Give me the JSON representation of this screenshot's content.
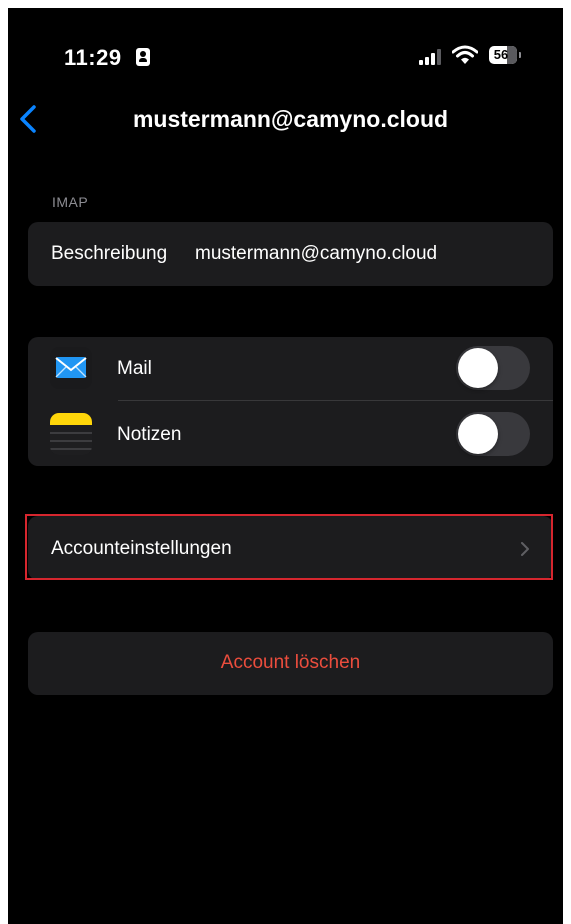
{
  "status_bar": {
    "time": "11:29",
    "battery": "56",
    "icons": [
      "contact-card-icon",
      "signal-icon",
      "wifi-icon",
      "battery-icon"
    ]
  },
  "nav": {
    "back_icon": "chevron-left-icon",
    "title": "mustermann@camyno.cloud"
  },
  "imap_section": {
    "header": "IMAP",
    "description_label": "Beschreibung",
    "description_value": "mustermann@camyno.cloud"
  },
  "services": [
    {
      "label": "Mail",
      "icon": "mail-app-icon",
      "enabled": false
    },
    {
      "label": "Notizen",
      "icon": "notes-app-icon",
      "enabled": false
    }
  ],
  "account_settings": {
    "label": "Accounteinstellungen",
    "icon": "chevron-right-icon",
    "highlighted": true,
    "highlight_color": "#d6262e"
  },
  "delete_account": {
    "label": "Account löschen",
    "color": "#eb4d3d"
  },
  "colors": {
    "background": "#000000",
    "cell_background": "#1c1c1e",
    "accent": "#0a84ff",
    "secondary_text": "#8d8d93",
    "toggle_off": "#39393d"
  }
}
